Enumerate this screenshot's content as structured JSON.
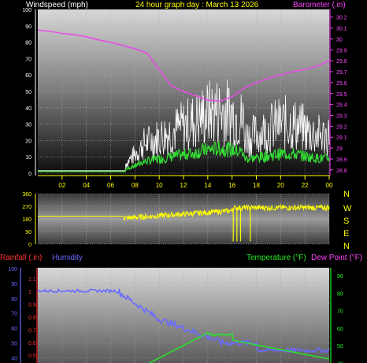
{
  "chart_data": [
    {
      "type": "line",
      "title": "24 hour graph day : March 13 2026",
      "left_axis_label": "Windspeed (mph)",
      "right_axis_label": "Barometer (.in)",
      "x_ticks": [
        "02",
        "04",
        "06",
        "08",
        "10",
        "12",
        "14",
        "16",
        "18",
        "20",
        "22",
        "00"
      ],
      "y_left": {
        "ticks": [
          "0",
          "10",
          "20",
          "30",
          "40",
          "50",
          "60",
          "70",
          "80",
          "90",
          "100"
        ],
        "range": [
          0,
          100
        ]
      },
      "y_right": {
        "ticks": [
          "28.8",
          "28.9",
          "29",
          "29.1",
          "29.2",
          "29.3",
          "29.4",
          "29.5",
          "29.6",
          "29.7",
          "29.8",
          "29.9",
          "30",
          "30.1",
          "30.2"
        ],
        "range": [
          28.77,
          30.27
        ]
      },
      "colors": {
        "barometer": "#e64de6",
        "gust": "#ffffff",
        "average": "#33dd33",
        "calm": "#aaddaa"
      },
      "series": [
        {
          "name": "Barometer (.in)",
          "x": [
            0,
            1,
            2,
            3,
            4,
            5,
            6,
            7,
            8,
            9,
            10,
            11,
            12,
            13,
            14,
            15,
            16,
            17,
            18,
            19,
            20,
            21,
            22,
            23,
            24
          ],
          "values": [
            30.08,
            30.07,
            30.05,
            30.04,
            30.02,
            29.99,
            29.97,
            29.94,
            29.91,
            29.87,
            29.72,
            29.57,
            29.52,
            29.48,
            29.44,
            29.43,
            29.47,
            29.55,
            29.6,
            29.64,
            29.67,
            29.7,
            29.72,
            29.75,
            29.8
          ]
        }
      ]
    },
    {
      "type": "line",
      "right_axis_labels": [
        "N",
        "W",
        "S",
        "E",
        "N"
      ],
      "y_ticks": [
        "360",
        "270",
        "180",
        "90",
        "0"
      ],
      "range": [
        0,
        360
      ],
      "color": "#ffff00",
      "note_ticks": []
    },
    {
      "type": "line",
      "left_labels": [
        "Rainfall (.in)",
        "Humidity"
      ],
      "right_labels": [
        "Temperature (°F)",
        "Dew Point (°F)"
      ],
      "humidity_ticks": [
        "100",
        "90",
        "80",
        "70",
        "60",
        "50",
        "40"
      ],
      "rain_ticks": [
        "1.1",
        "1",
        "0.9",
        "0.8",
        "0.7",
        "0.6",
        "0.5"
      ],
      "temp_ticks": [
        "90",
        "80",
        "70",
        "60",
        "50",
        "40"
      ],
      "colors": {
        "rain": "#ff3333",
        "humidity": "#6b6bff",
        "temperature": "#22ee22",
        "dewpoint": "#ff44ff"
      }
    }
  ]
}
